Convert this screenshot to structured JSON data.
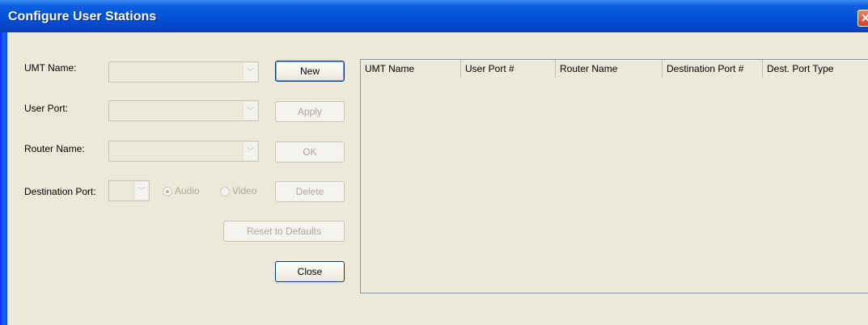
{
  "window": {
    "title": "Configure User Stations",
    "close_glyph": "✕"
  },
  "form": {
    "umt_name_label": "UMT Name:",
    "user_port_label": "User Port:",
    "router_name_label": "Router Name:",
    "destination_port_label": "Destination Port:",
    "umt_name_value": "",
    "user_port_value": "",
    "router_name_value": "",
    "destination_port_value": "",
    "dropdown_arrow": "﹀",
    "audio_label": "Audio",
    "video_label": "Video",
    "selected_type": "Audio"
  },
  "buttons": {
    "new": "New",
    "apply": "Apply",
    "ok": "OK",
    "delete": "Delete",
    "reset": "Reset to Defaults",
    "close": "Close"
  },
  "table": {
    "columns": [
      "UMT Name",
      "User Port #",
      "Router Name",
      "Destination Port #",
      "Dest. Port Type"
    ],
    "rows": []
  }
}
